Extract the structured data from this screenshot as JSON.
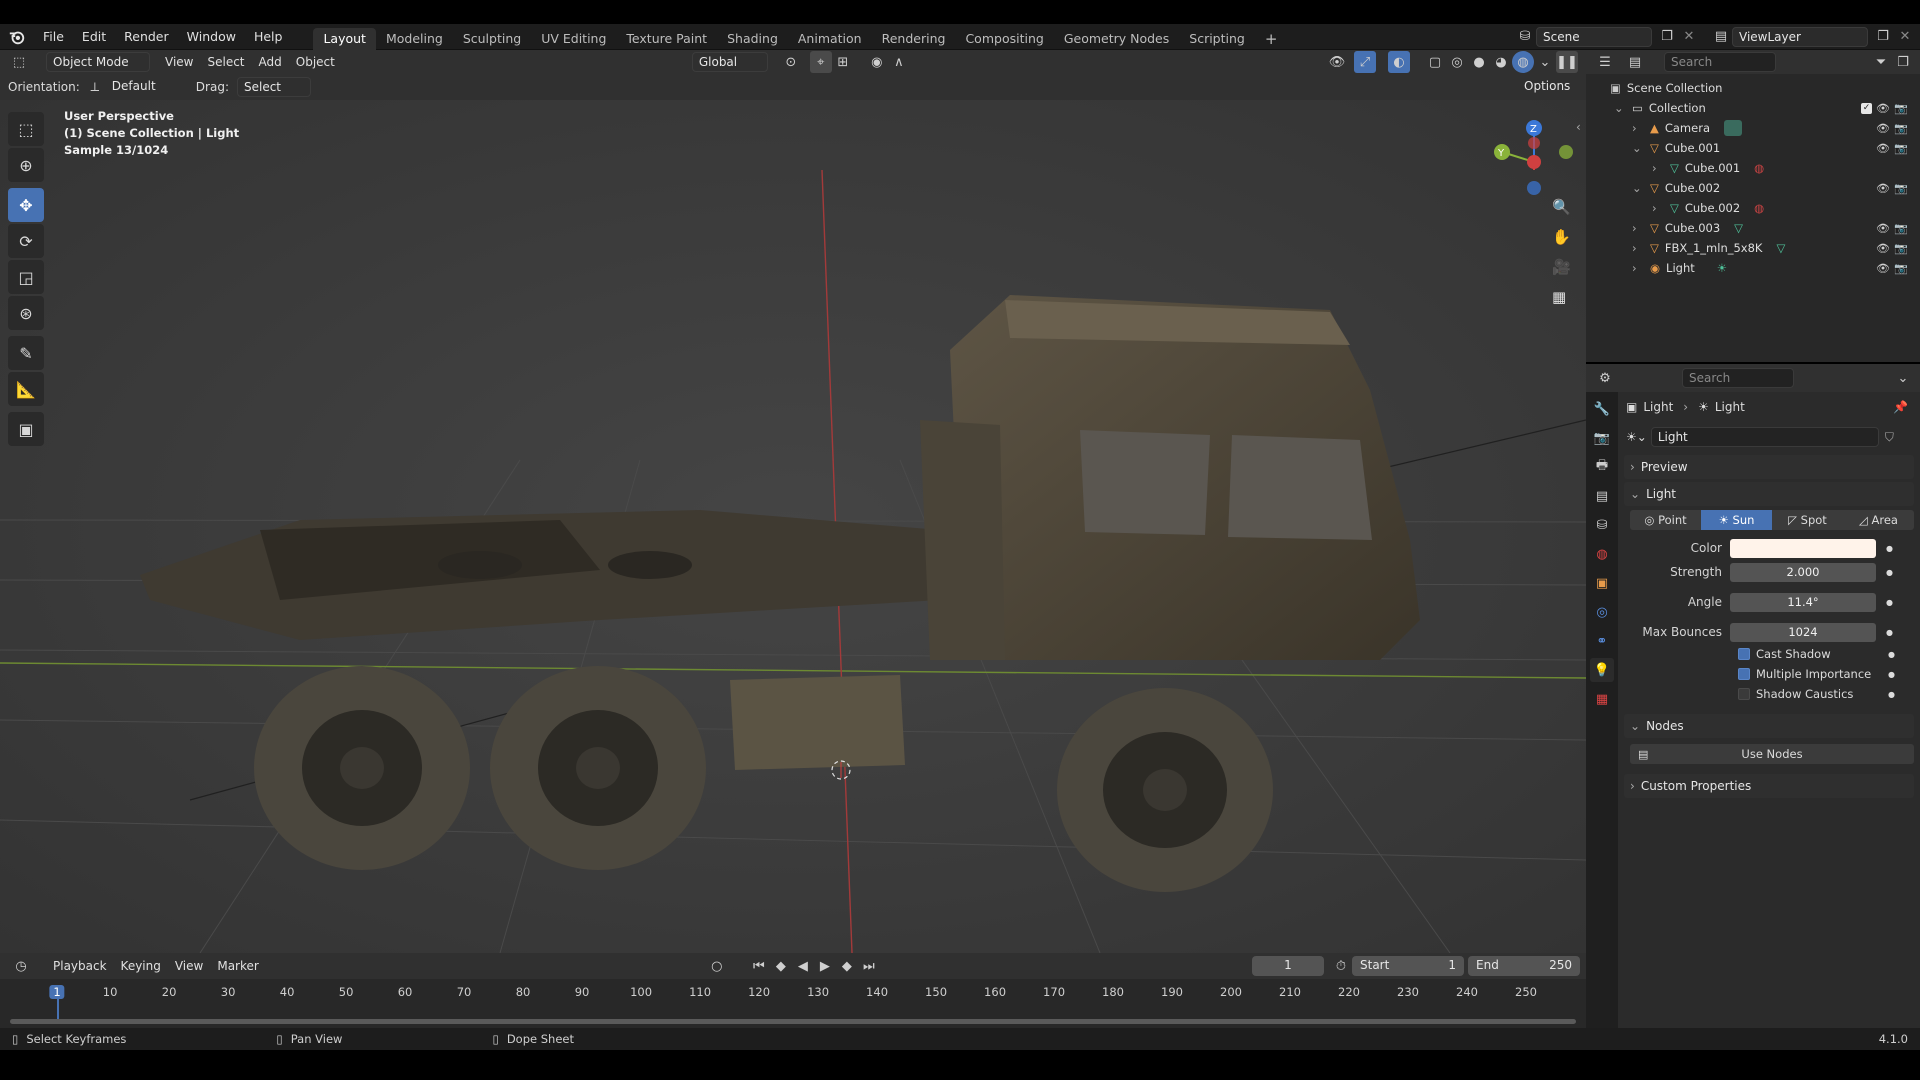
{
  "menus": [
    "File",
    "Edit",
    "Render",
    "Window",
    "Help"
  ],
  "workspaces": [
    "Layout",
    "Modeling",
    "Sculpting",
    "UV Editing",
    "Texture Paint",
    "Shading",
    "Animation",
    "Rendering",
    "Compositing",
    "Geometry Nodes",
    "Scripting"
  ],
  "active_workspace": "Layout",
  "scene_name": "Scene",
  "view_layer": "ViewLayer",
  "viewport_header": {
    "mode": "Object Mode",
    "menus": [
      "View",
      "Select",
      "Add",
      "Object"
    ],
    "transform": "Global",
    "orientation_label": "Orientation:",
    "orientation_value": "Default",
    "drag_label": "Drag:",
    "drag_value": "Select Box",
    "options": "Options"
  },
  "viewport_info": {
    "line1": "User Perspective",
    "line2": "(1) Scene Collection | Light",
    "line3": "Sample 13/1024"
  },
  "gizmo_axes": {
    "z": "Z",
    "y": "Y"
  },
  "outliner": {
    "search_placeholder": "Search",
    "root": "Scene Collection",
    "items": [
      {
        "label": "Collection",
        "level": 0
      },
      {
        "label": "Camera",
        "level": 1
      },
      {
        "label": "Cube.001",
        "level": 1
      },
      {
        "label": "Cube.001",
        "level": 2
      },
      {
        "label": "Cube.002",
        "level": 1
      },
      {
        "label": "Cube.002",
        "level": 2
      },
      {
        "label": "Cube.003",
        "level": 1
      },
      {
        "label": "FBX_1_mln_5x8K",
        "level": 1
      },
      {
        "label": "Light",
        "level": 1
      }
    ]
  },
  "properties": {
    "search_placeholder": "Search",
    "breadcrumb": [
      "Light",
      "Light"
    ],
    "datablock": "Light",
    "panels": {
      "preview": "Preview",
      "light": "Light",
      "nodes": "Nodes",
      "custom": "Custom Properties"
    },
    "light_types": [
      "Point",
      "Sun",
      "Spot",
      "Area"
    ],
    "active_type": "Sun",
    "fields": [
      {
        "label": "Color",
        "value": ""
      },
      {
        "label": "Strength",
        "value": "2.000"
      },
      {
        "label": "Angle",
        "value": "11.4°"
      },
      {
        "label": "Max Bounces",
        "value": "1024"
      }
    ],
    "checks": [
      {
        "label": "Cast Shadow",
        "checked": true
      },
      {
        "label": "Multiple Importance",
        "checked": true
      },
      {
        "label": "Shadow Caustics",
        "checked": false
      }
    ],
    "use_nodes": "Use Nodes"
  },
  "timeline": {
    "menus": [
      "Playback",
      "Keying",
      "View",
      "Marker"
    ],
    "current_frame": "1",
    "start_label": "Start",
    "start": "1",
    "end_label": "End",
    "end": "250",
    "ticks": [
      "1",
      "10",
      "20",
      "30",
      "40",
      "50",
      "60",
      "70",
      "80",
      "90",
      "100",
      "110",
      "120",
      "130",
      "140",
      "150",
      "160",
      "170",
      "180",
      "190",
      "200",
      "210",
      "220",
      "230",
      "240",
      "250"
    ]
  },
  "statusbar": {
    "left": "Select Keyframes",
    "middle": "Pan View",
    "right": "Dope Sheet",
    "version": "4.1.0"
  },
  "colors": {
    "accent": "#4772b3",
    "light_color": "#fff3ea"
  }
}
